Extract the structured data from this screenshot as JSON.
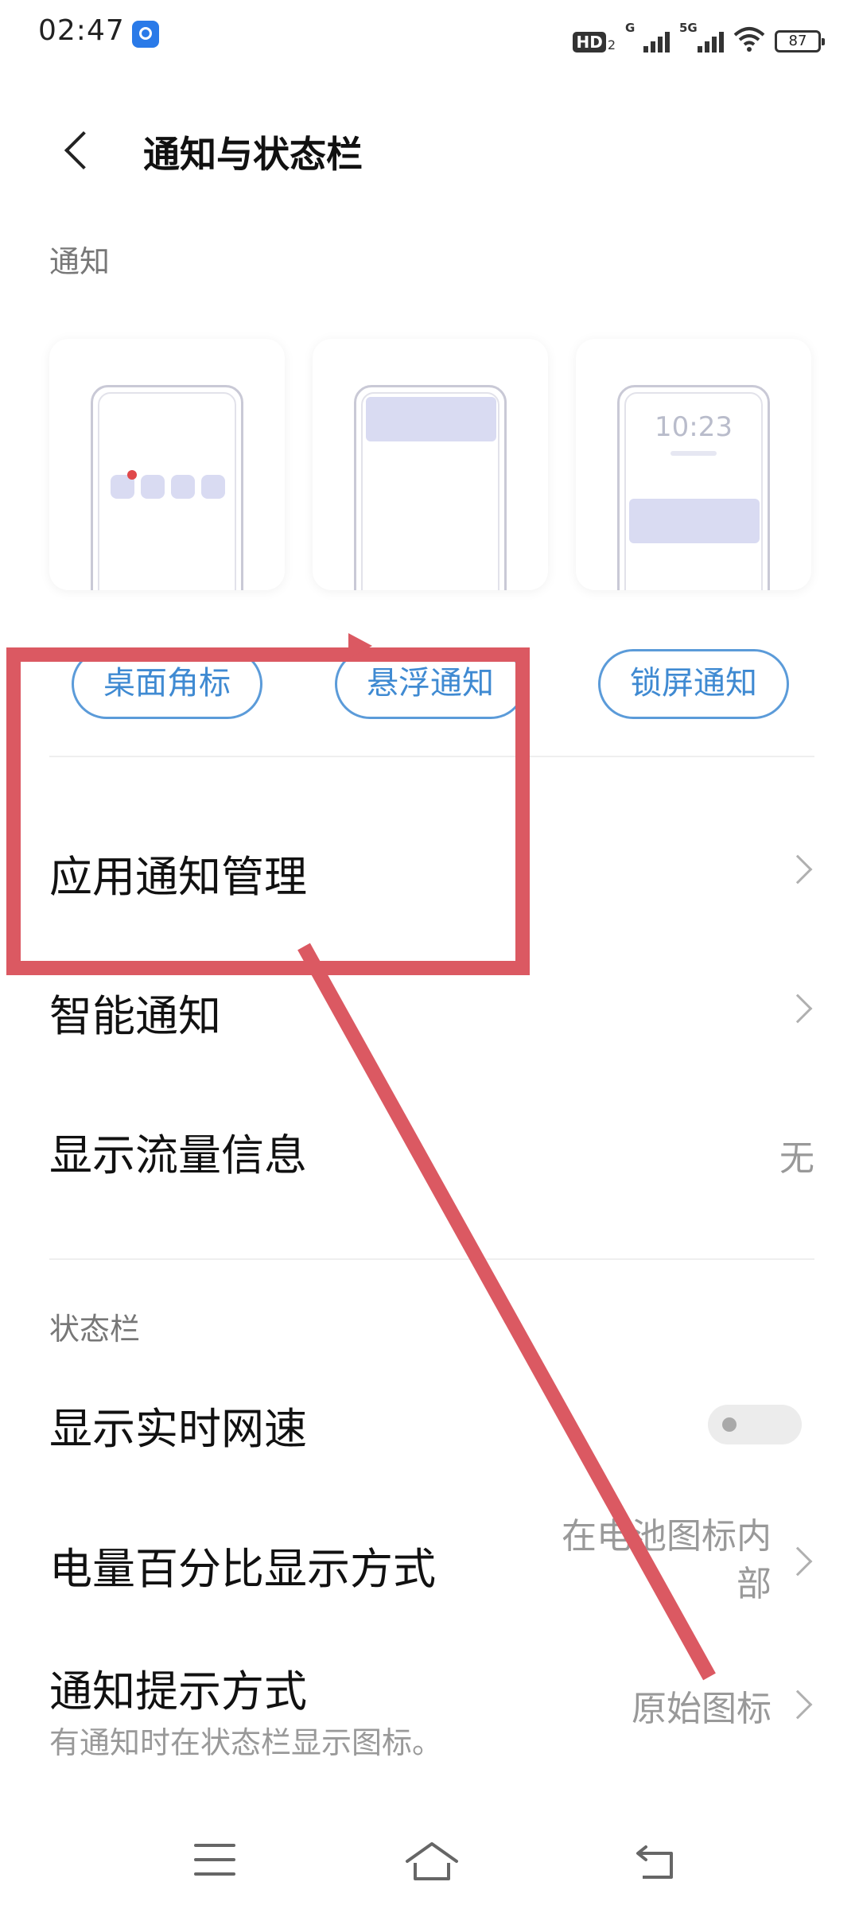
{
  "status_bar": {
    "time": "02:47",
    "hd_label": "HD",
    "hd_sub": "2",
    "net1_tag": "G",
    "net2_tag": "5G",
    "battery": "87"
  },
  "header": {
    "title": "通知与状态栏"
  },
  "notification_section": {
    "label": "通知",
    "cards": [
      {
        "icon": "desktop-badge-illustration"
      },
      {
        "icon": "floating-notification-illustration"
      },
      {
        "icon": "lockscreen-notification-illustration",
        "lock_time": "10:23"
      }
    ],
    "pills": [
      "桌面角标",
      "悬浮通知",
      "锁屏通知"
    ]
  },
  "rows": {
    "app_notification_mgmt": "应用通知管理",
    "smart_notification": "智能通知",
    "data_usage": {
      "label": "显示流量信息",
      "value": "无"
    }
  },
  "statusbar_section": {
    "label": "状态栏",
    "realtime_speed": {
      "label": "显示实时网速",
      "enabled": false
    },
    "battery_percent": {
      "label": "电量百分比显示方式",
      "value_line1": "在电池图标内",
      "value_line2": "部"
    },
    "notify_style": {
      "label": "通知提示方式",
      "sub": "有通知时在状态栏显示图标。",
      "value": "原始图标"
    }
  },
  "nav_bar": {
    "menu_icon": "menu-icon",
    "home_icon": "home-icon",
    "back_icon": "back-icon"
  },
  "annotation": {
    "color": "#db5962"
  },
  "colors": {
    "accent": "#3f8ad2",
    "illustration": "#d9dbf2",
    "badge": "#e0484a"
  }
}
